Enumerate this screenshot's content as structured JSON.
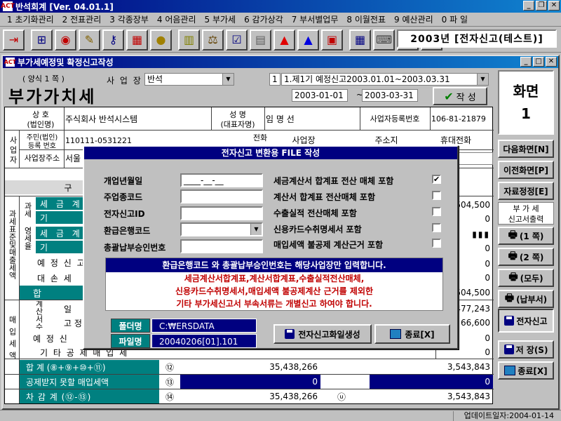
{
  "app": {
    "title": "반석회계 [Ver. 04.01.1]",
    "logo": "ACT"
  },
  "menu": [
    "1 초기화관리",
    "2 전표관리",
    "3 각종장부",
    "4 어음관리",
    "5 부가세",
    "6 감가상각",
    "7 부서별업무",
    "8 이월전표",
    "9 예산관리",
    "0 파 일"
  ],
  "toolbar_icons": [
    "exit-icon",
    "org-chart-icon",
    "globe-icon",
    "pencil-icon",
    "key-icon",
    "calculator-icon",
    "coin-icon",
    "notebook-icon",
    "scale-icon",
    "checklist-icon",
    "register-icon",
    "arrow-up-red-icon",
    "arrow-up-blue-icon",
    "report-icon",
    "grid-icon",
    "keyboard-icon",
    "refresh-icon",
    "save-disk-icon"
  ],
  "year_box": "2003년 [전자신고(테스트)]",
  "window": {
    "title": "부가세예정및 확정신고작성"
  },
  "form": {
    "form_no": "( 양식 1 쪽 )",
    "title": "부가가치세",
    "business_label": "사 업 장",
    "business_value": "반석",
    "period_no": "1",
    "period_value": "1.제1기 예정신고2003.01.01~2003.03.31",
    "date_from": "2003-01-01",
    "date_to": "2003-03-31",
    "date_sep": "~",
    "create_button": "작 성",
    "company_label_1": "상 호",
    "company_label_2": "(법인명)",
    "company_value": "주식회사 반석시스템",
    "rep_label_1": "성 명",
    "rep_label_2": "(대표자명)",
    "rep_value": "임 명 선",
    "regno_label": "사업자등록번호",
    "regno_value": "106-81-21879",
    "side_label": "사업자",
    "corp_label_1": "주민(법인)",
    "corp_label_2": "등록 번호",
    "corp_value": "110111-0531221",
    "addr_label": "사업장주소",
    "addr_value": "서울",
    "contact_header": "전화",
    "contact_business": "사업장",
    "contact_address": "주소지",
    "contact_mobile": "휴대전화",
    "col_header": "구",
    "section_vat": "과세표준및매출세액",
    "section_purchase": "매입세액",
    "rows": [
      {
        "col1": "과세",
        "col2": "세 금 계",
        "right": "504,500"
      },
      {
        "col1": "",
        "col2": "기",
        "right": "0"
      },
      {
        "col1": "영세율",
        "col2": "세 금 계",
        "right": "▮▮▮"
      },
      {
        "col1": "",
        "col2": "기",
        "right": "0"
      },
      {
        "col1": "예 정 신 고",
        "col2": "",
        "right": "0"
      },
      {
        "col1": "대 손 세",
        "col2": "",
        "right": "0"
      },
      {
        "col1": "합",
        "col2": "",
        "right": "504,500"
      }
    ],
    "purchase_rows": [
      {
        "col1": "세금계산서수취분",
        "col2": "일",
        "right": "477,243"
      },
      {
        "col1": "",
        "col2": "고 정",
        "right": "66,600"
      },
      {
        "col1": "예 정 신",
        "col2": "",
        "right": "0"
      },
      {
        "col1": "기 타 공 제 매 입 세",
        "col2": "",
        "right": "0"
      }
    ],
    "total_row": {
      "label": "합 계 (⑧+⑨+⑩+⑪)",
      "circle": "⑫",
      "amount": "35,438,266",
      "right": "3,543,843"
    },
    "nondeduct_row": {
      "label": "공제받지 못할 매입세액",
      "circle": "⑬",
      "amount": "0",
      "right": "0"
    },
    "diff_row": {
      "label": "차 감 계 (⑫-⑬)",
      "circle": "⑭",
      "amount": "35,438,266",
      "mid": "ⓤ",
      "right": "3,543,843"
    }
  },
  "right_panel": {
    "screen_label_1": "화면",
    "screen_label_2": "1",
    "next_button": "다음화면[N]",
    "prev_button": "이전화면[P]",
    "edit_button": "자료정정[E]",
    "vat_print_1": "부 가 세",
    "vat_print_2": "신고서출력",
    "print1": "(1 쪽)",
    "print2": "(2 쪽)",
    "print_all": "(모두)",
    "print_pay": "(납부서)",
    "e_filing": "전자신고",
    "save": "저 장(S)",
    "exit": "종료[X]"
  },
  "dialog": {
    "title": "전자신고 변환용 FILE 작성",
    "fields": [
      {
        "label": "개업년월일",
        "value": "____-__-__"
      },
      {
        "label": "주업종코드",
        "value": ""
      },
      {
        "label": "전자신고ID",
        "value": ""
      },
      {
        "label": "환급은행코드",
        "value": ""
      },
      {
        "label": "총괄납부승인번호",
        "value": ""
      }
    ],
    "checks": [
      {
        "label": "세금계산서 합계표 전산 매체 포함",
        "checked": "✔"
      },
      {
        "label": "계산서 합계표 전산매체 포함",
        "checked": ""
      },
      {
        "label": "수출실적 전산매체 포함",
        "checked": ""
      },
      {
        "label": "신용카드수취명세서 포함",
        "checked": ""
      },
      {
        "label": "매입세액 불공제 계산근거 포함",
        "checked": ""
      }
    ],
    "notice1": "환급은행코드 와 총괄납부승인번호는 해당사업장만 입력합니다.",
    "notice2": "세금계산서합계표,계산서합계표,수출실적전산매체,",
    "notice3": "신용카드수취명세서,매입세액 불공제계산 근거를 제외한",
    "notice4": "기타 부가세신고서 부속서류는 개별신고 하여야 합니다.",
    "folder_label": "폴더명",
    "folder_value": "C:₩ERSDATA",
    "file_label": "파일명",
    "file_value": "20040206[01].101",
    "generate_button": "전자신고화일생성",
    "close_button": "종료[X]"
  },
  "status": {
    "update_date": "업데이트일자:2004-01-14"
  }
}
